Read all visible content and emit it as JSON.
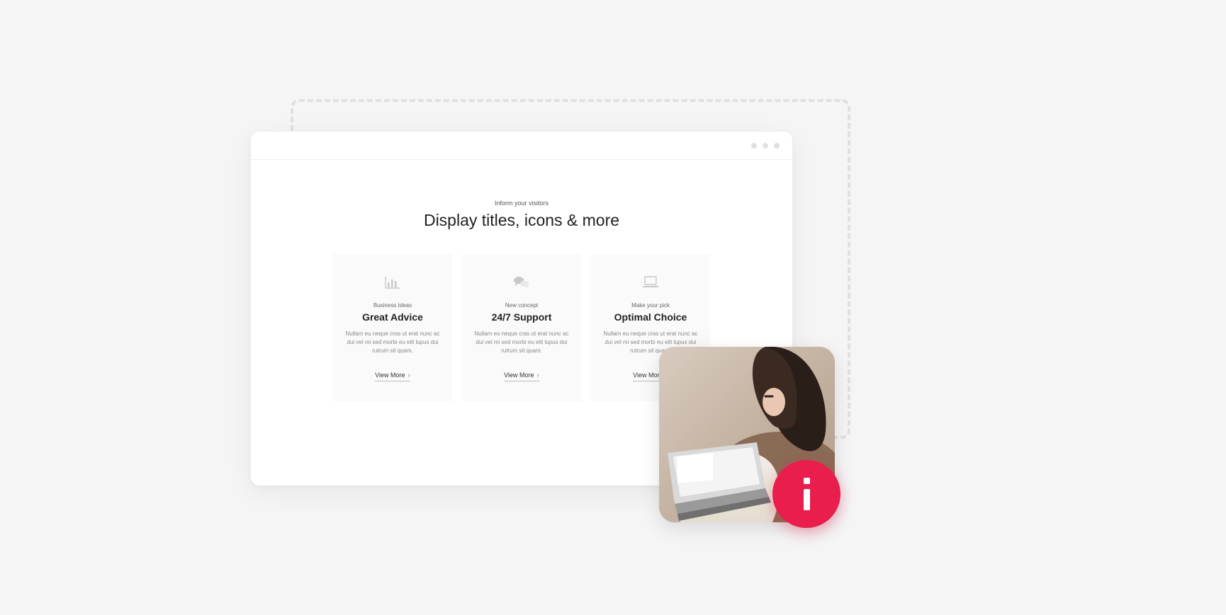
{
  "hero": {
    "eyebrow": "Inform your visitors",
    "headline": "Display titles, icons & more"
  },
  "cards": [
    {
      "icon": "bar-chart-icon",
      "eyebrow": "Business Ideas",
      "title": "Great Advice",
      "body": "Nullam eu neque cras ut erat nunc ac dui vel mi sed morbi eu elit lupus dui rutrum sit quam.",
      "link": "View More"
    },
    {
      "icon": "chat-bubbles-icon",
      "eyebrow": "New concept",
      "title": "24/7 Support",
      "body": "Nullam eu neque cras ut erat nunc ac dui vel mi sed morbi eu elit lupus dui rutrum sit quam.",
      "link": "View More"
    },
    {
      "icon": "laptop-icon",
      "eyebrow": "Make your pick",
      "title": "Optimal Choice",
      "body": "Nullam eu neque cras ut erat nunc ac dui vel mi sed morbi eu elit lupus dui rutrum sit quam.",
      "link": "View More"
    }
  ],
  "infoBadge": {
    "glyph": "i"
  }
}
